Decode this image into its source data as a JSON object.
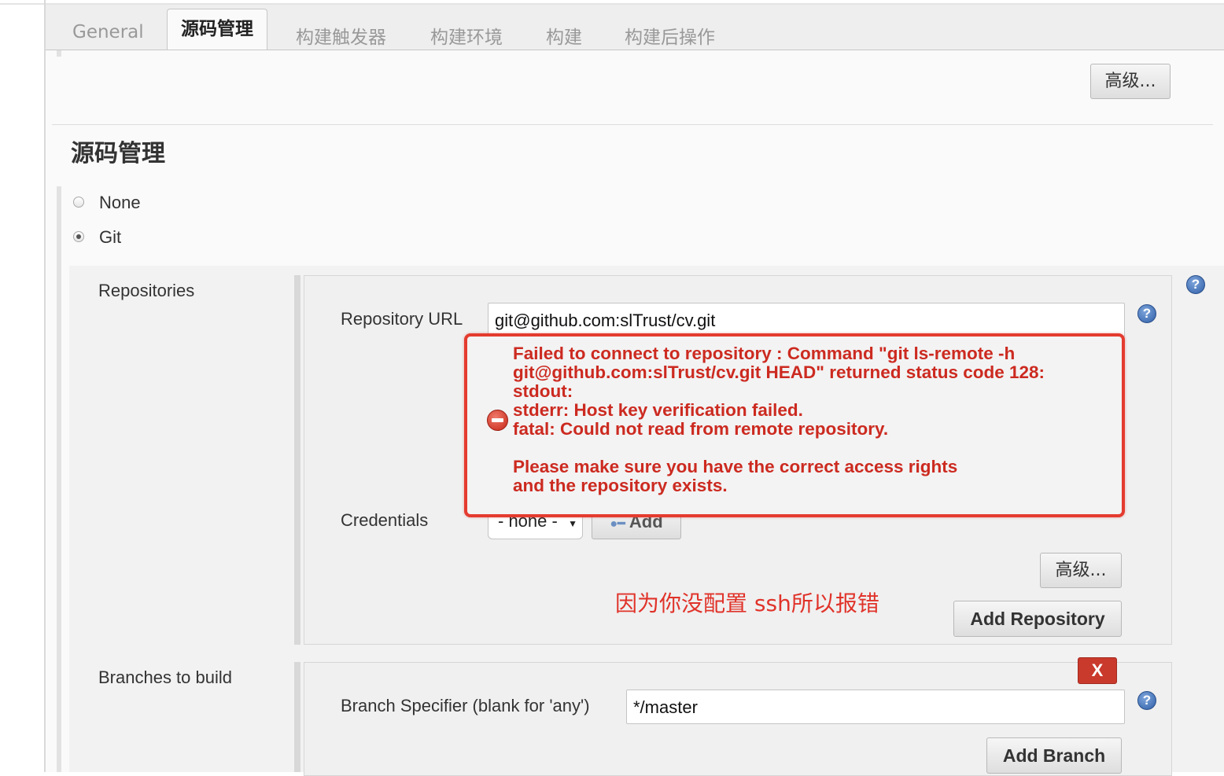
{
  "tabs": [
    {
      "label": "General",
      "active": false
    },
    {
      "label": "源码管理",
      "active": true
    },
    {
      "label": "构建触发器",
      "active": false
    },
    {
      "label": "构建环境",
      "active": false
    },
    {
      "label": "构建",
      "active": false
    },
    {
      "label": "构建后操作",
      "active": false
    }
  ],
  "advanced_label": "高级...",
  "section_title": "源码管理",
  "scm_options": [
    {
      "label": "None",
      "selected": false
    },
    {
      "label": "Git",
      "selected": true
    }
  ],
  "repositories": {
    "label": "Repositories",
    "url_label": "Repository URL",
    "url_value": "git@github.com:slTrust/cv.git",
    "error_lines": "Failed to connect to repository : Command \"git ls-remote -h\ngit@github.com:slTrust/cv.git HEAD\" returned status code 128:\nstdout:\nstderr: Host key verification failed.\nfatal: Could not read from remote repository.\n\nPlease make sure you have the correct access rights\nand the repository exists.",
    "credentials_label": "Credentials",
    "credentials_value": "- none -",
    "add_credentials_label": "Add",
    "advanced_label": "高级...",
    "add_repository_label": "Add Repository"
  },
  "annotation": "因为你没配置 ssh所以报错",
  "branches": {
    "label": "Branches to build",
    "delete_label": "X",
    "specifier_label": "Branch Specifier (blank for 'any')",
    "specifier_value": "*/master",
    "add_branch_label": "Add Branch"
  },
  "help_glyph": "?",
  "colors": {
    "error": "#cc2a20",
    "annotation": "#e0332a",
    "delete_button": "#c9392c",
    "help_icon": "#2f5fa8"
  }
}
